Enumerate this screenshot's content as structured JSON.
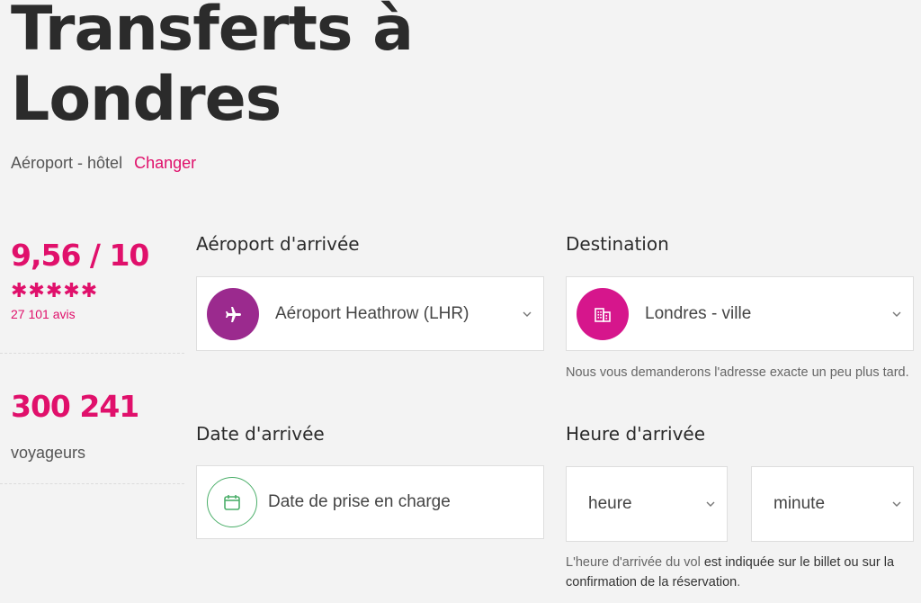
{
  "header": {
    "title_line1": "Transferts à",
    "title_line2": "Londres",
    "route": "Aéroport - hôtel",
    "change_link": "Changer"
  },
  "stats": {
    "rating": "9,56 / 10",
    "stars": "✱✱✱✱✱",
    "star_count": 5,
    "reviews": "27 101 avis",
    "travellers_count": "300 241",
    "travellers_label": "voyageurs"
  },
  "form": {
    "arrival_airport": {
      "label": "Aéroport d'arrivée",
      "value": "Aéroport Heathrow (LHR)",
      "icon": "airplane-icon"
    },
    "destination": {
      "label": "Destination",
      "value": "Londres - ville",
      "icon": "building-icon",
      "hint": "Nous vous demanderons l'adresse exacte un peu plus tard."
    },
    "arrival_date": {
      "label": "Date d'arrivée",
      "placeholder": "Date de prise en charge",
      "icon": "calendar-icon"
    },
    "arrival_time": {
      "label": "Heure d'arrivée",
      "hour_placeholder": "heure",
      "minute_placeholder": "minute",
      "hint_prefix": "L'heure d'arrivée du vol ",
      "hint_strong": "est indiquée sur le billet ou sur la confirmation de la réservation",
      "hint_suffix": "."
    }
  },
  "colors": {
    "accent": "#e0106b",
    "airport_icon_bg": "#9b2a8e",
    "destination_icon_bg": "#d6168c",
    "calendar_icon": "#4caf6a",
    "background": "#f3f3f3"
  }
}
